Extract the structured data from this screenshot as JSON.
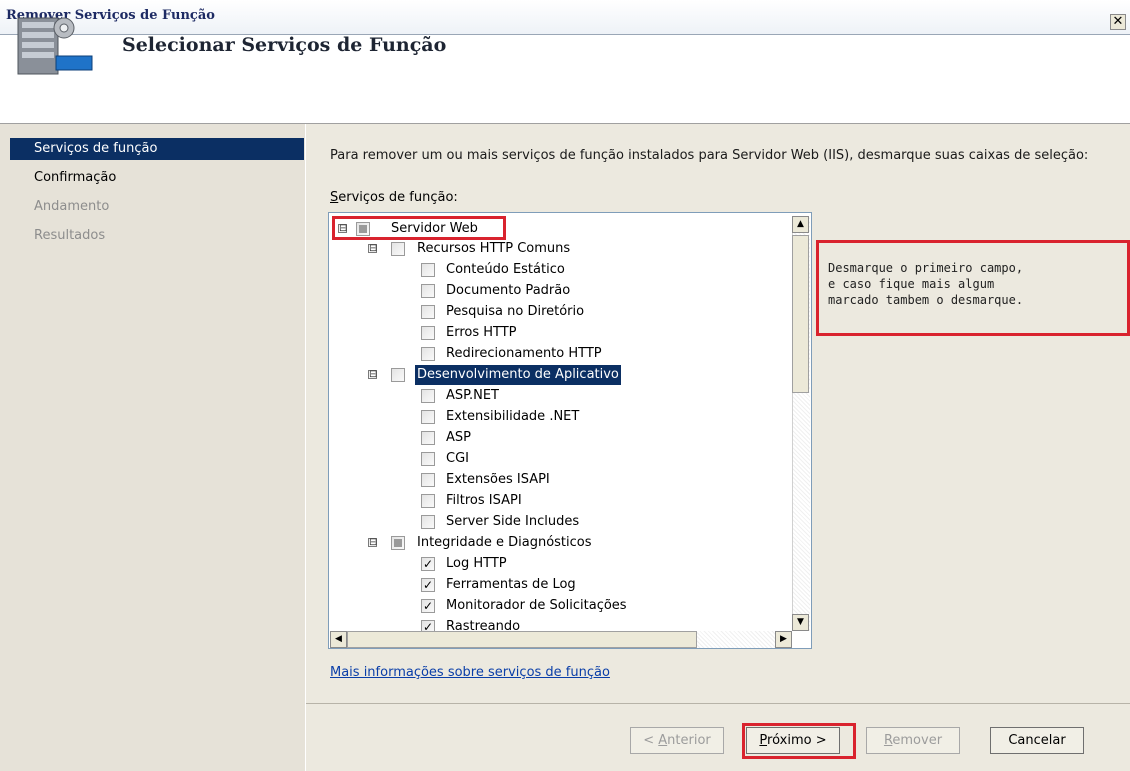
{
  "window": {
    "title": "Remover Serviços de Função",
    "close_glyph": "✕",
    "header_title": "Selecionar Serviços de Função"
  },
  "sidebar": {
    "items": [
      {
        "label": "Serviços de função",
        "state": "active"
      },
      {
        "label": "Confirmação",
        "state": "enabled"
      },
      {
        "label": "Andamento",
        "state": "disabled"
      },
      {
        "label": "Resultados",
        "state": "disabled"
      }
    ]
  },
  "main": {
    "description": "Para remover um ou mais serviços de função instalados para Servidor Web (IIS), desmarque suas caixas de seleção:",
    "list_label_accel": "S",
    "list_label_rest": "erviços de função:",
    "more_link": "Mais informações sobre serviços de função"
  },
  "tree": [
    {
      "label": "Servidor Web",
      "state": "partial",
      "expander": "⊟"
    },
    {
      "label": "Recursos HTTP Comuns",
      "state": "unchecked",
      "expander": "⊟"
    },
    {
      "label": "Conteúdo Estático",
      "state": "unchecked"
    },
    {
      "label": "Documento Padrão",
      "state": "unchecked"
    },
    {
      "label": "Pesquisa no Diretório",
      "state": "unchecked"
    },
    {
      "label": "Erros HTTP",
      "state": "unchecked"
    },
    {
      "label": "Redirecionamento HTTP",
      "state": "unchecked"
    },
    {
      "label": "Desenvolvimento de Aplicativo",
      "state": "unchecked",
      "expander": "⊟",
      "selected": true
    },
    {
      "label": "ASP.NET",
      "state": "unchecked"
    },
    {
      "label": "Extensibilidade .NET",
      "state": "unchecked"
    },
    {
      "label": "ASP",
      "state": "unchecked"
    },
    {
      "label": "CGI",
      "state": "unchecked"
    },
    {
      "label": "Extensões ISAPI",
      "state": "unchecked"
    },
    {
      "label": "Filtros ISAPI",
      "state": "unchecked"
    },
    {
      "label": "Server Side Includes",
      "state": "unchecked"
    },
    {
      "label": "Integridade e Diagnósticos",
      "state": "partial",
      "expander": "⊟"
    },
    {
      "label": "Log HTTP",
      "state": "checked"
    },
    {
      "label": "Ferramentas de Log",
      "state": "checked"
    },
    {
      "label": "Monitorador de Solicitações",
      "state": "checked"
    },
    {
      "label": "Rastreando",
      "state": "checked"
    }
  ],
  "buttons": {
    "prev_prefix": "< ",
    "prev_accel": "A",
    "prev_rest": "nterior",
    "next_accel": "P",
    "next_rest": "róximo >",
    "remove_accel": "R",
    "remove_rest": "emover",
    "cancel": "Cancelar"
  },
  "annotation": {
    "text": "Desmarque o primeiro campo,\ne caso fique mais algum\nmarcado tambem o desmarque."
  },
  "colors": {
    "highlight": "#d9232e",
    "selection": "#0b2f63",
    "link": "#0a3ea8"
  }
}
